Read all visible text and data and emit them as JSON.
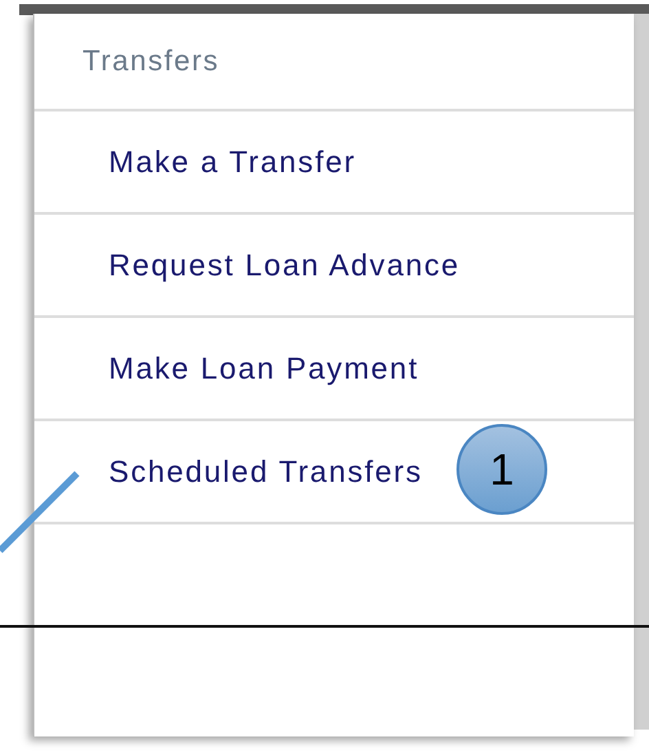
{
  "menu": {
    "header": "Transfers",
    "items": [
      {
        "label": "Make a Transfer"
      },
      {
        "label": "Request Loan Advance"
      },
      {
        "label": "Make Loan Payment"
      },
      {
        "label": "Scheduled Transfers",
        "callout": "1"
      }
    ]
  }
}
